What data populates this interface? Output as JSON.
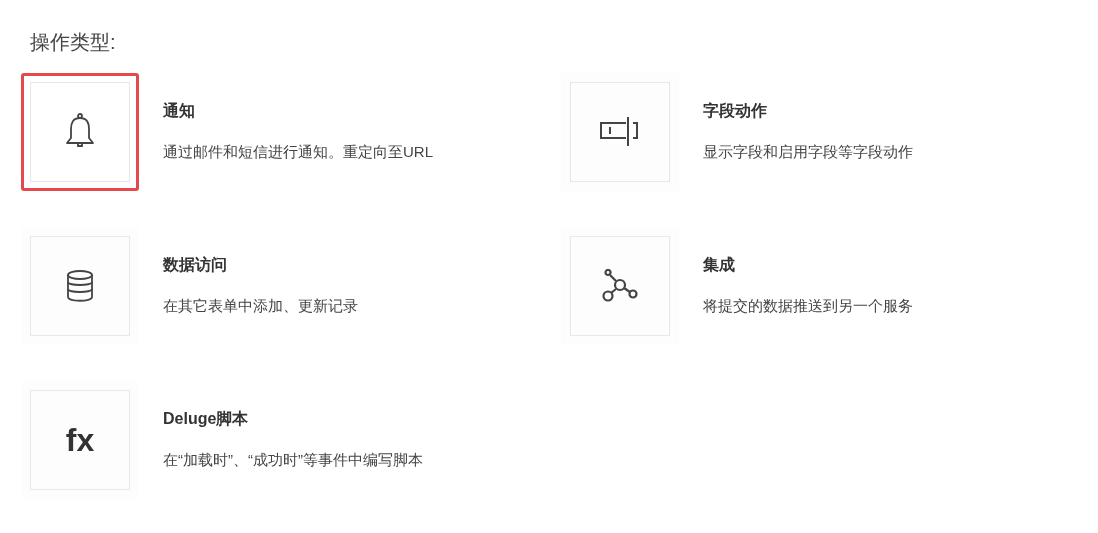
{
  "heading": "操作类型:",
  "actions": [
    {
      "kind": "bell",
      "title": "通知",
      "description": "通过邮件和短信进行通知。重定向至URL",
      "selected": true
    },
    {
      "kind": "field",
      "title": "字段动作",
      "description": "显示字段和启用字段等字段动作",
      "selected": false
    },
    {
      "kind": "database",
      "title": "数据访问",
      "description": "在其它表单中添加、更新记录",
      "selected": false
    },
    {
      "kind": "network",
      "title": "集成",
      "description": "将提交的数据推送到另一个服务",
      "selected": false
    },
    {
      "kind": "glyph",
      "glyph": "fx",
      "title": "Deluge脚本",
      "description": "在“加载时”、“成功时”等事件中编写脚本",
      "selected": false
    }
  ]
}
